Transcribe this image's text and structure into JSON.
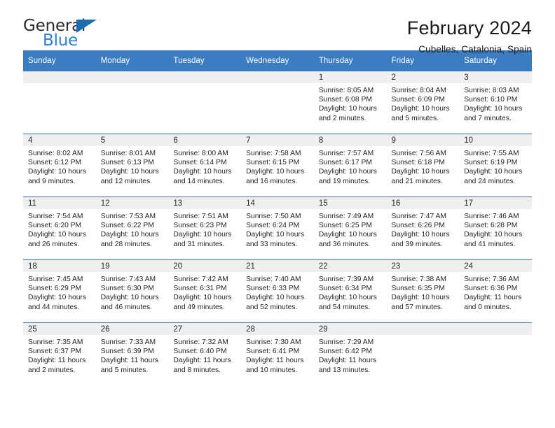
{
  "brand": {
    "name_part1": "General",
    "name_part2": "Blue"
  },
  "header": {
    "month_title": "February 2024",
    "location": "Cubelles, Catalonia, Spain"
  },
  "colors": {
    "header_blue": "#3b7dc0",
    "row_border_blue": "#2f6ea8",
    "daynum_band": "#efefef",
    "brand_blue": "#2b7fd4"
  },
  "weekdays": [
    "Sunday",
    "Monday",
    "Tuesday",
    "Wednesday",
    "Thursday",
    "Friday",
    "Saturday"
  ],
  "labels": {
    "sunrise": "Sunrise:",
    "sunset": "Sunset:",
    "daylight": "Daylight:"
  },
  "weeks": [
    [
      {
        "day": "",
        "sunrise": "",
        "sunset": "",
        "daylight_1": "",
        "daylight_2": ""
      },
      {
        "day": "",
        "sunrise": "",
        "sunset": "",
        "daylight_1": "",
        "daylight_2": ""
      },
      {
        "day": "",
        "sunrise": "",
        "sunset": "",
        "daylight_1": "",
        "daylight_2": ""
      },
      {
        "day": "",
        "sunrise": "",
        "sunset": "",
        "daylight_1": "",
        "daylight_2": ""
      },
      {
        "day": "1",
        "sunrise": "Sunrise: 8:05 AM",
        "sunset": "Sunset: 6:08 PM",
        "daylight_1": "Daylight: 10 hours",
        "daylight_2": "and 2 minutes."
      },
      {
        "day": "2",
        "sunrise": "Sunrise: 8:04 AM",
        "sunset": "Sunset: 6:09 PM",
        "daylight_1": "Daylight: 10 hours",
        "daylight_2": "and 5 minutes."
      },
      {
        "day": "3",
        "sunrise": "Sunrise: 8:03 AM",
        "sunset": "Sunset: 6:10 PM",
        "daylight_1": "Daylight: 10 hours",
        "daylight_2": "and 7 minutes."
      }
    ],
    [
      {
        "day": "4",
        "sunrise": "Sunrise: 8:02 AM",
        "sunset": "Sunset: 6:12 PM",
        "daylight_1": "Daylight: 10 hours",
        "daylight_2": "and 9 minutes."
      },
      {
        "day": "5",
        "sunrise": "Sunrise: 8:01 AM",
        "sunset": "Sunset: 6:13 PM",
        "daylight_1": "Daylight: 10 hours",
        "daylight_2": "and 12 minutes."
      },
      {
        "day": "6",
        "sunrise": "Sunrise: 8:00 AM",
        "sunset": "Sunset: 6:14 PM",
        "daylight_1": "Daylight: 10 hours",
        "daylight_2": "and 14 minutes."
      },
      {
        "day": "7",
        "sunrise": "Sunrise: 7:58 AM",
        "sunset": "Sunset: 6:15 PM",
        "daylight_1": "Daylight: 10 hours",
        "daylight_2": "and 16 minutes."
      },
      {
        "day": "8",
        "sunrise": "Sunrise: 7:57 AM",
        "sunset": "Sunset: 6:17 PM",
        "daylight_1": "Daylight: 10 hours",
        "daylight_2": "and 19 minutes."
      },
      {
        "day": "9",
        "sunrise": "Sunrise: 7:56 AM",
        "sunset": "Sunset: 6:18 PM",
        "daylight_1": "Daylight: 10 hours",
        "daylight_2": "and 21 minutes."
      },
      {
        "day": "10",
        "sunrise": "Sunrise: 7:55 AM",
        "sunset": "Sunset: 6:19 PM",
        "daylight_1": "Daylight: 10 hours",
        "daylight_2": "and 24 minutes."
      }
    ],
    [
      {
        "day": "11",
        "sunrise": "Sunrise: 7:54 AM",
        "sunset": "Sunset: 6:20 PM",
        "daylight_1": "Daylight: 10 hours",
        "daylight_2": "and 26 minutes."
      },
      {
        "day": "12",
        "sunrise": "Sunrise: 7:53 AM",
        "sunset": "Sunset: 6:22 PM",
        "daylight_1": "Daylight: 10 hours",
        "daylight_2": "and 28 minutes."
      },
      {
        "day": "13",
        "sunrise": "Sunrise: 7:51 AM",
        "sunset": "Sunset: 6:23 PM",
        "daylight_1": "Daylight: 10 hours",
        "daylight_2": "and 31 minutes."
      },
      {
        "day": "14",
        "sunrise": "Sunrise: 7:50 AM",
        "sunset": "Sunset: 6:24 PM",
        "daylight_1": "Daylight: 10 hours",
        "daylight_2": "and 33 minutes."
      },
      {
        "day": "15",
        "sunrise": "Sunrise: 7:49 AM",
        "sunset": "Sunset: 6:25 PM",
        "daylight_1": "Daylight: 10 hours",
        "daylight_2": "and 36 minutes."
      },
      {
        "day": "16",
        "sunrise": "Sunrise: 7:47 AM",
        "sunset": "Sunset: 6:26 PM",
        "daylight_1": "Daylight: 10 hours",
        "daylight_2": "and 39 minutes."
      },
      {
        "day": "17",
        "sunrise": "Sunrise: 7:46 AM",
        "sunset": "Sunset: 6:28 PM",
        "daylight_1": "Daylight: 10 hours",
        "daylight_2": "and 41 minutes."
      }
    ],
    [
      {
        "day": "18",
        "sunrise": "Sunrise: 7:45 AM",
        "sunset": "Sunset: 6:29 PM",
        "daylight_1": "Daylight: 10 hours",
        "daylight_2": "and 44 minutes."
      },
      {
        "day": "19",
        "sunrise": "Sunrise: 7:43 AM",
        "sunset": "Sunset: 6:30 PM",
        "daylight_1": "Daylight: 10 hours",
        "daylight_2": "and 46 minutes."
      },
      {
        "day": "20",
        "sunrise": "Sunrise: 7:42 AM",
        "sunset": "Sunset: 6:31 PM",
        "daylight_1": "Daylight: 10 hours",
        "daylight_2": "and 49 minutes."
      },
      {
        "day": "21",
        "sunrise": "Sunrise: 7:40 AM",
        "sunset": "Sunset: 6:33 PM",
        "daylight_1": "Daylight: 10 hours",
        "daylight_2": "and 52 minutes."
      },
      {
        "day": "22",
        "sunrise": "Sunrise: 7:39 AM",
        "sunset": "Sunset: 6:34 PM",
        "daylight_1": "Daylight: 10 hours",
        "daylight_2": "and 54 minutes."
      },
      {
        "day": "23",
        "sunrise": "Sunrise: 7:38 AM",
        "sunset": "Sunset: 6:35 PM",
        "daylight_1": "Daylight: 10 hours",
        "daylight_2": "and 57 minutes."
      },
      {
        "day": "24",
        "sunrise": "Sunrise: 7:36 AM",
        "sunset": "Sunset: 6:36 PM",
        "daylight_1": "Daylight: 11 hours",
        "daylight_2": "and 0 minutes."
      }
    ],
    [
      {
        "day": "25",
        "sunrise": "Sunrise: 7:35 AM",
        "sunset": "Sunset: 6:37 PM",
        "daylight_1": "Daylight: 11 hours",
        "daylight_2": "and 2 minutes."
      },
      {
        "day": "26",
        "sunrise": "Sunrise: 7:33 AM",
        "sunset": "Sunset: 6:39 PM",
        "daylight_1": "Daylight: 11 hours",
        "daylight_2": "and 5 minutes."
      },
      {
        "day": "27",
        "sunrise": "Sunrise: 7:32 AM",
        "sunset": "Sunset: 6:40 PM",
        "daylight_1": "Daylight: 11 hours",
        "daylight_2": "and 8 minutes."
      },
      {
        "day": "28",
        "sunrise": "Sunrise: 7:30 AM",
        "sunset": "Sunset: 6:41 PM",
        "daylight_1": "Daylight: 11 hours",
        "daylight_2": "and 10 minutes."
      },
      {
        "day": "29",
        "sunrise": "Sunrise: 7:29 AM",
        "sunset": "Sunset: 6:42 PM",
        "daylight_1": "Daylight: 11 hours",
        "daylight_2": "and 13 minutes."
      },
      {
        "day": "",
        "sunrise": "",
        "sunset": "",
        "daylight_1": "",
        "daylight_2": ""
      },
      {
        "day": "",
        "sunrise": "",
        "sunset": "",
        "daylight_1": "",
        "daylight_2": ""
      }
    ]
  ]
}
